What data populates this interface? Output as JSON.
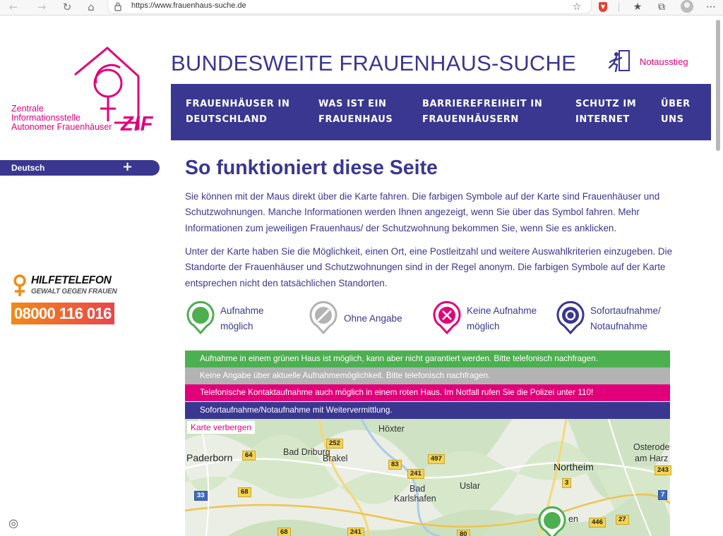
{
  "browser": {
    "url": "https://www.frauenhaus-suche.de",
    "back_icon": "arrow-left",
    "forward_icon": "arrow-right",
    "reload_icon": "reload",
    "home_icon": "home"
  },
  "site": {
    "title": "BUNDESWEITE FRAUENHAUS-SUCHE",
    "logo_lines": [
      "Zentrale",
      "Informationsstelle",
      "Autonomer Frauenhäuser"
    ],
    "logo_abbr": "ZIF",
    "exit_label": "Notausstieg",
    "brand_color": "#3a3791",
    "accent_color": "#e2007a"
  },
  "nav": [
    {
      "line1": "FRAUENHÄUSER IN",
      "line2": "DEUTSCHLAND"
    },
    {
      "line1": "WAS IST EIN",
      "line2": "FRAUENHAUS"
    },
    {
      "line1": "BARRIEREFREIHEIT IN",
      "line2": "FRAUENHÄUSERN"
    },
    {
      "line1": "SCHUTZ IM",
      "line2": "INTERNET"
    },
    {
      "line1": "ÜBER",
      "line2": "UNS"
    }
  ],
  "language": {
    "label": "Deutsch",
    "toggle": "+"
  },
  "hilfe": {
    "title": "HILFETELEFON",
    "subtitle": "GEWALT GEGEN FRAUEN",
    "number": "08000 116 016"
  },
  "main": {
    "heading": "So funktioniert diese Seite",
    "p1": "Sie können mit der Maus direkt über die Karte fahren. Die farbigen Symbole auf der Karte sind Frauenhäuser und Schutzwohnungen. Manche Informationen werden Ihnen angezeigt, wenn Sie über das Symbol fahren. Mehr Informationen zum jeweiligen Frauenhaus/ der Schutzwohnung bekommen Sie, wenn Sie es anklicken.",
    "p2": "Unter der Karte haben Sie die Möglichkeit, einen Ort, eine Postleitzahl und weitere Auswahlkriterien einzugeben. Die Standorte der Frauenhäuser und Schutzwohnungen sind in der Regel anonym. Die farbigen Symbole auf der Karte entsprechen nicht den tatsächlichen Standorten."
  },
  "legend": [
    {
      "line1": "Aufnahme",
      "line2": "möglich",
      "color": "#4caf50",
      "icon": "green-circle-marker"
    },
    {
      "line1": "Ohne Angabe",
      "line2": "",
      "color": "#b3b3b3",
      "icon": "grey-slash-marker"
    },
    {
      "line1": "Keine Aufnahme",
      "line2": "möglich",
      "color": "#e2007a",
      "icon": "pink-x-marker"
    },
    {
      "line1": "Sofortaufnahme/",
      "line2": "Notaufnahme",
      "color": "#3a3791",
      "icon": "blue-ring-marker"
    }
  ],
  "bars": {
    "green": "Aufnahme in einem grünen Haus ist möglich, kann aber nicht garantiert werden. Bitte telefonisch nachfragen.",
    "grey": "Keine Angabe über aktuelle Aufnahmemöglichkeit. Bitte telefonisch nachfragen.",
    "pink": "Telefonische Kontaktaufnahme auch möglich in einem roten Haus. Im Notfall rufen Sie die Polizei unter 110!",
    "blue": "Sofortaufnahme/Notaufnahme mit Weitervermittlung."
  },
  "map": {
    "toggle": "Karte verbergen",
    "cities": [
      "Höxter",
      "Bad Driburg",
      "Brakel",
      "Paderborn",
      "Bad",
      "Karlshafen",
      "Uslar",
      "Northeim",
      "Osterode",
      "am Harz",
      "en"
    ],
    "roads": [
      "252",
      "64",
      "497",
      "83",
      "241",
      "3",
      "68",
      "33",
      "68",
      "241",
      "80",
      "446",
      "27",
      "243",
      "7"
    ]
  }
}
